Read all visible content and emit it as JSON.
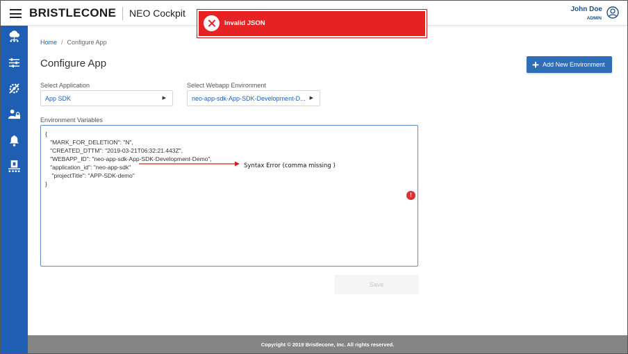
{
  "header": {
    "brand": "BRISTLECONE",
    "product": "NEO Cockpit",
    "user_name": "John Doe",
    "user_role": "ADMIN"
  },
  "toast": {
    "message": "Invalid JSON",
    "color": "#e62222"
  },
  "sidebar": {
    "color": "#1f5fb3",
    "items": [
      {
        "icon": "cloud-network-icon"
      },
      {
        "icon": "sliders-icon"
      },
      {
        "icon": "settings-tools-icon"
      },
      {
        "icon": "user-lock-icon"
      },
      {
        "icon": "bell-icon"
      },
      {
        "icon": "package-conveyor-icon"
      }
    ]
  },
  "breadcrumb": {
    "home": "Home",
    "separator": "/",
    "current": "Configure App"
  },
  "page": {
    "title": "Configure App",
    "add_button": "Add New Environment"
  },
  "form": {
    "application_label": "Select Application",
    "application_value": "App SDK",
    "environment_label": "Select Webapp Environment",
    "environment_value": "neo-app-sdk-App-SDK-Development-D...",
    "variables_label": "Environment Variables",
    "json_lines": [
      "{",
      "   \"MARK_FOR_DELETION\": \"N\",",
      "   \"CREATED_DTTM\": \"2019-03-21T06:32:21.443Z\",",
      "   \"WEBAPP_ID\": \"neo-app-sdk-App-SDK-Development-Demo\",",
      "   \"application_id\": \"neo-app-sdk\"",
      "    \"projectTitle\": \"APP-SDK-demo\"",
      "}"
    ],
    "save_button": "Save"
  },
  "annotation": {
    "text": "Syntax Error (comma missing )"
  },
  "footer": {
    "text": "Copyright © 2019 Bristlecone, Inc. All rights reserved."
  }
}
